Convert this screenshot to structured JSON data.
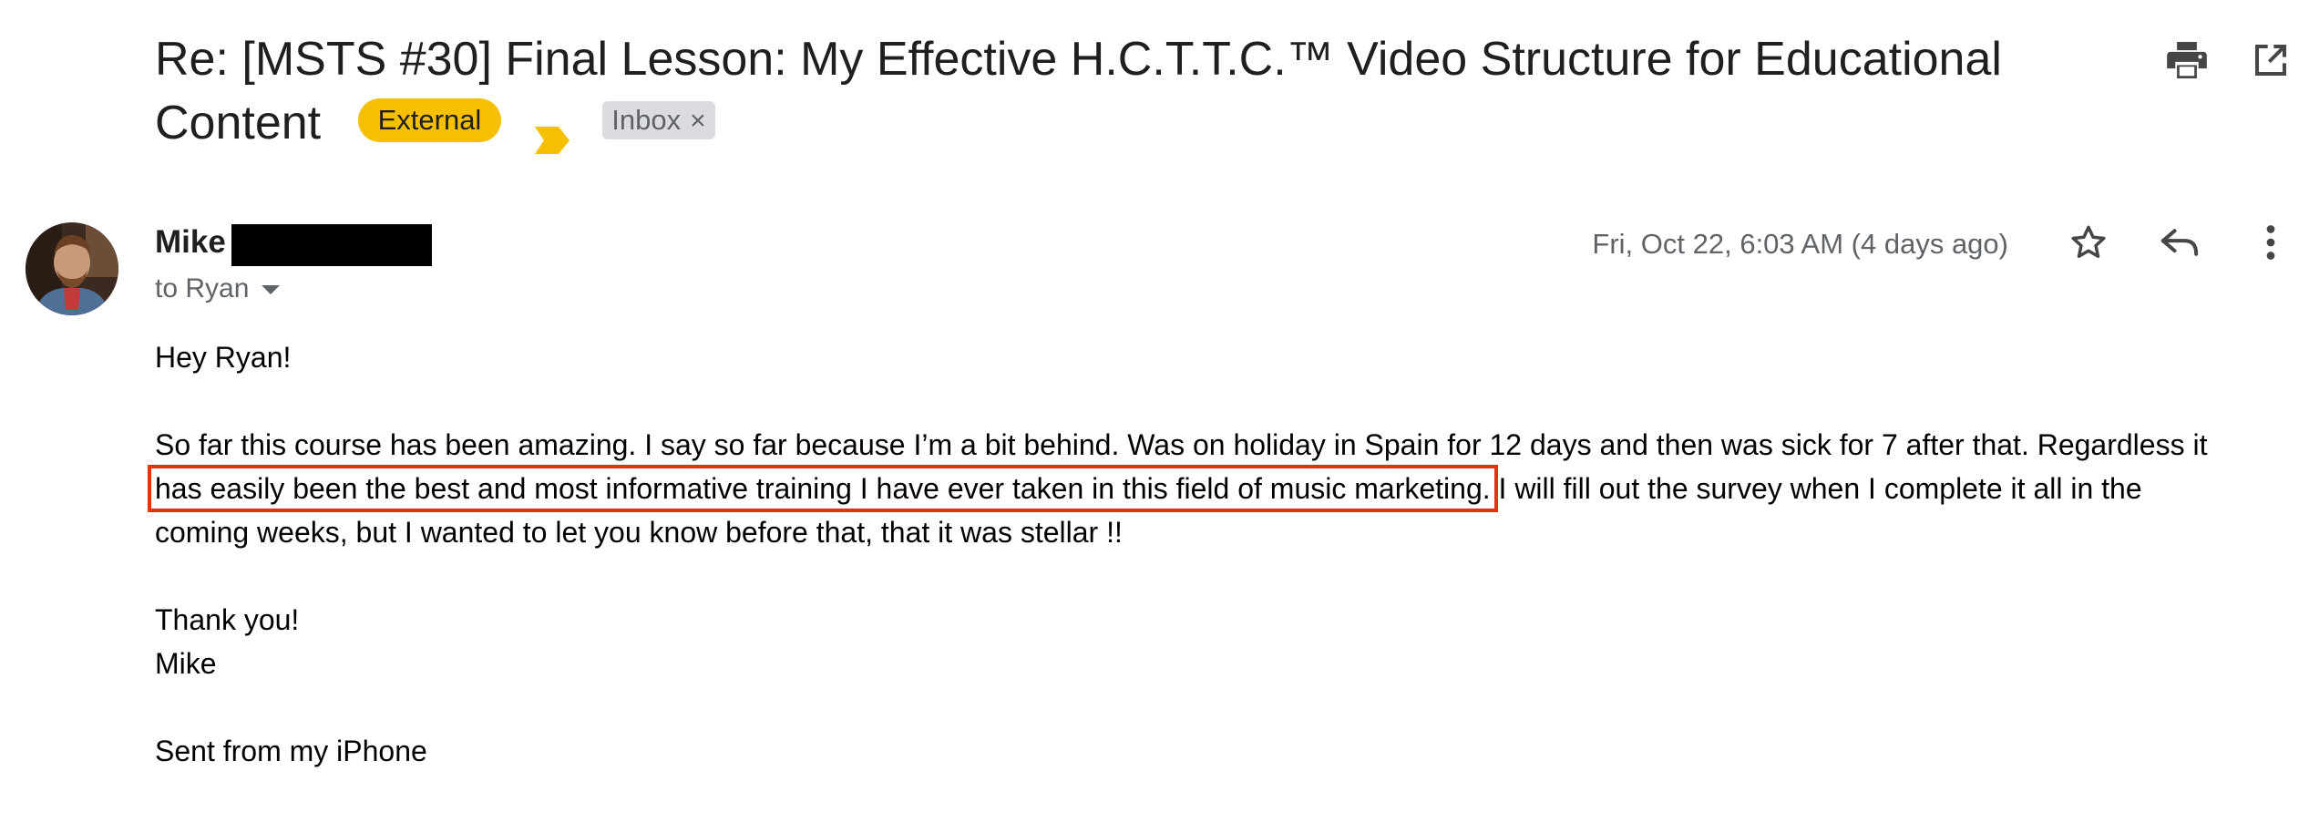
{
  "subject": {
    "text": "Re: [MSTS #30] Final Lesson: My Effective H.C.T.T.C.™ Video Structure for Educational Content",
    "external_label": "External",
    "inbox_label": "Inbox",
    "inbox_remove": "×"
  },
  "toolbar": {
    "print_icon": "print-icon",
    "open_new_window_icon": "open-in-new-window-icon"
  },
  "message": {
    "sender_name": "Mike",
    "recipient_text": "to Ryan",
    "date": "Fri, Oct 22, 6:03 AM (4 days ago)",
    "greeting": "Hey Ryan!",
    "para1_line1": "So far this course has been amazing. I say so far because I’m a bit behind. Was on holiday in Spain for 12 days and then was sick for 7 after that. Regardless it",
    "para1_highlight": "has easily been the best and most informative training I have ever taken in this field of music marketing.",
    "para1_rest": " I will fill out the survey when I complete it all in the",
    "para1_line3": "coming weeks, but I wanted to let you know before that, that it was stellar !!",
    "thanks": "Thank you!",
    "signoff": "Mike",
    "signature": "Sent from my iPhone"
  },
  "colors": {
    "external_chip": "#f6bf00",
    "important_marker": "#f6bf00",
    "inbox_chip": "#dadce0",
    "highlight_box": "#e53212",
    "meta_text": "#5f6368"
  }
}
